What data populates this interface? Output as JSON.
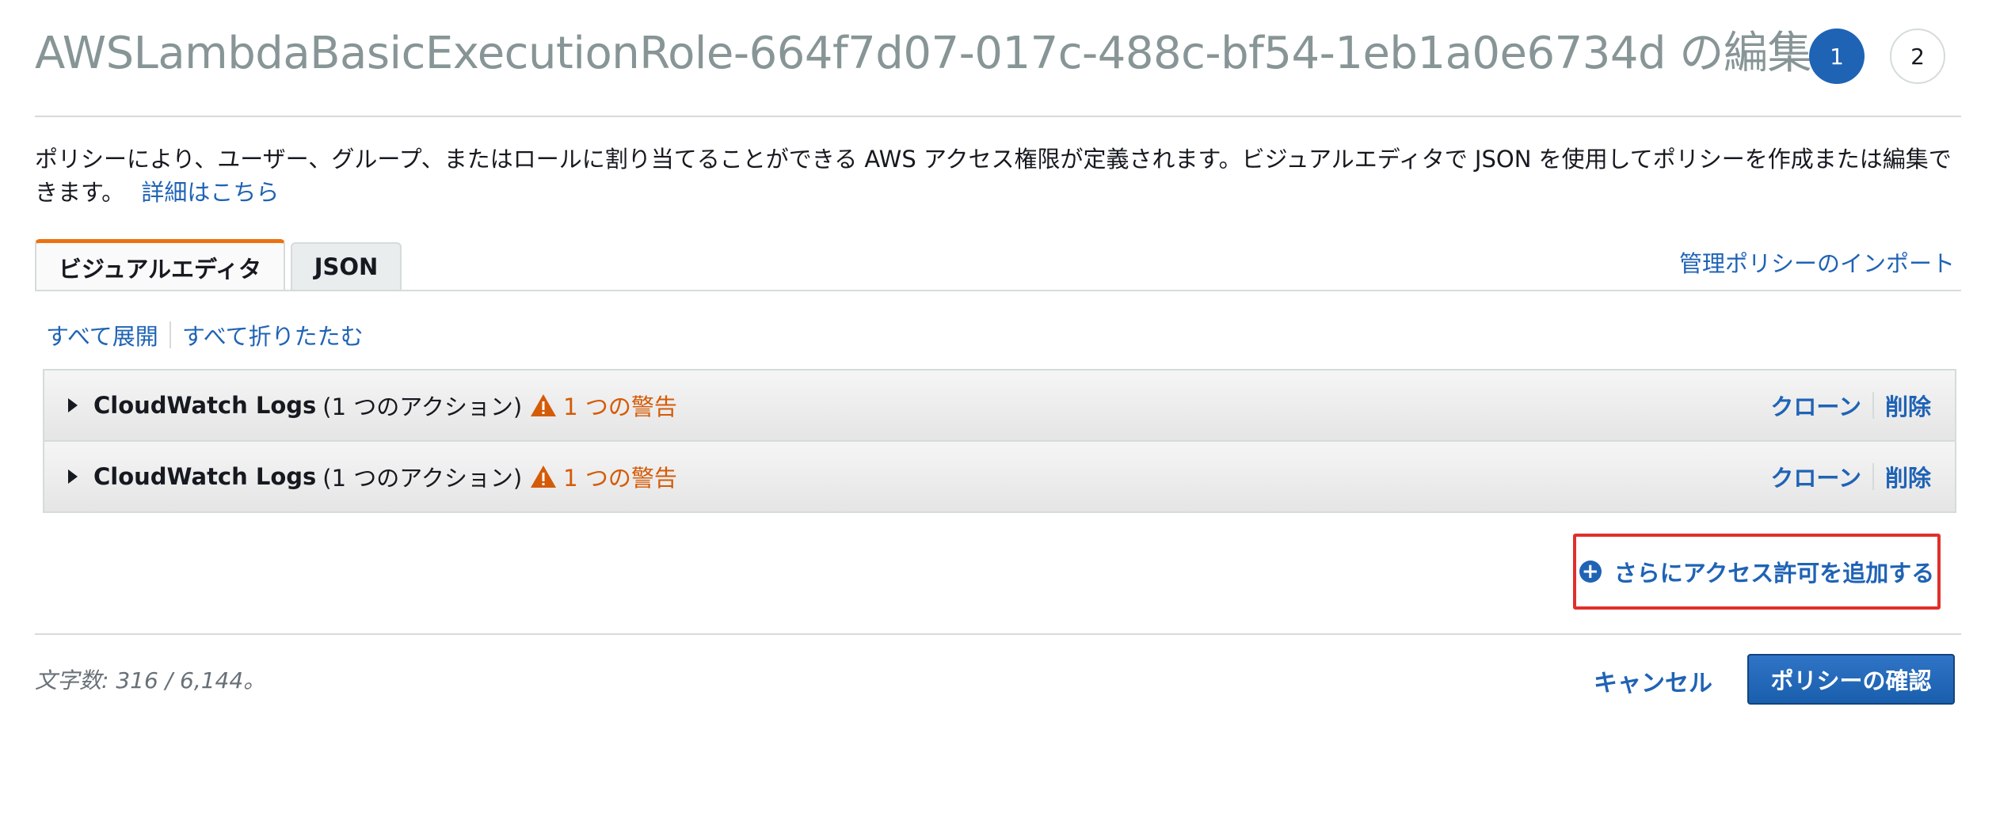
{
  "header": {
    "title": "AWSLambdaBasicExecutionRole-664f7d07-017c-488c-bf54-1eb1a0e6734d の編集",
    "steps": [
      "1",
      "2"
    ],
    "active_step": "1"
  },
  "description": {
    "text": "ポリシーにより、ユーザー、グループ、またはロールに割り当てることができる AWS アクセス権限が定義されます。ビジュアルエディタで JSON を使用してポリシーを作成または編集できます。",
    "link": "詳細はこちら"
  },
  "tabs": {
    "visual": "ビジュアルエディタ",
    "json": "JSON",
    "active": "ビジュアルエディタ"
  },
  "import_link": "管理ポリシーのインポート",
  "expand_all": "すべて展開",
  "collapse_all": "すべて折りたたむ",
  "statements": [
    {
      "service": "CloudWatch Logs",
      "actions": "(1 つのアクション)",
      "warning": "1 つの警告",
      "clone": "クローン",
      "delete": "削除"
    },
    {
      "service": "CloudWatch Logs",
      "actions": "(1 つのアクション)",
      "warning": "1 つの警告",
      "clone": "クローン",
      "delete": "削除"
    }
  ],
  "add_permissions": "さらにアクセス許可を追加する",
  "footer": {
    "char_count": "文字数: 316 / 6,144。",
    "cancel": "キャンセル",
    "confirm": "ポリシーの確認"
  },
  "colors": {
    "link": "#1f63b5",
    "warning": "#d45b07",
    "tab_accent": "#ec7211",
    "highlight_border": "#e0302b",
    "primary_button": "#1f63b5"
  },
  "icons": [
    "caret-right-icon",
    "warning-triangle-icon",
    "plus-circle-icon"
  ]
}
